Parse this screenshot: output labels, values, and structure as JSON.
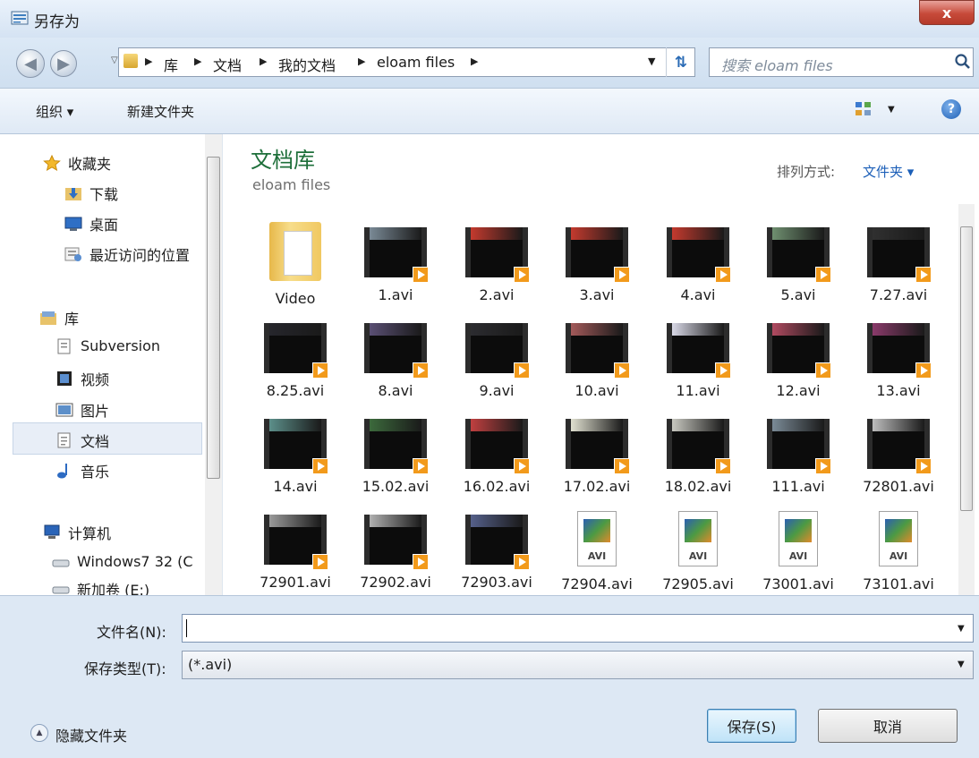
{
  "window": {
    "title": "另存为",
    "close_label": "x"
  },
  "address": {
    "crumbs": [
      "库",
      "文档",
      "我的文档",
      "eloam files"
    ],
    "search_placeholder": "搜索 eloam files"
  },
  "toolbar": {
    "organize": "组织 ▾",
    "new_folder": "新建文件夹"
  },
  "nav": {
    "favorites": "收藏夹",
    "downloads": "下载",
    "desktop": "桌面",
    "recent": "最近访问的位置",
    "libraries": "库",
    "subversion": "Subversion",
    "videos": "视频",
    "pictures": "图片",
    "documents": "文档",
    "music": "音乐",
    "computer": "计算机",
    "drive_c": "Windows7 32 (C",
    "drive_e": "新加卷 (E:)"
  },
  "content": {
    "library_title": "文档库",
    "library_subtitle": "eloam files",
    "sort_label": "排列方式:",
    "sort_value": "文件夹 ▾",
    "files": [
      "Video",
      "1.avi",
      "2.avi",
      "3.avi",
      "4.avi",
      "5.avi",
      "7.27.avi",
      "8.25.avi",
      "8.avi",
      "9.avi",
      "10.avi",
      "11.avi",
      "12.avi",
      "13.avi",
      "14.avi",
      "15.02.avi",
      "16.02.avi",
      "17.02.avi",
      "18.02.avi",
      "111.avi",
      "72801.avi",
      "72901.avi",
      "72902.avi",
      "72903.avi",
      "72904.avi",
      "72905.avi",
      "73001.avi",
      "73101.avi"
    ],
    "avi_icon_label": "AVI"
  },
  "form": {
    "filename_label": "文件名(N):",
    "filename_value": "",
    "filetype_label": "保存类型(T):",
    "filetype_value": "(*.avi)"
  },
  "footer": {
    "hide_folders": "隐藏文件夹",
    "save": "保存(S)",
    "cancel": "取消"
  }
}
